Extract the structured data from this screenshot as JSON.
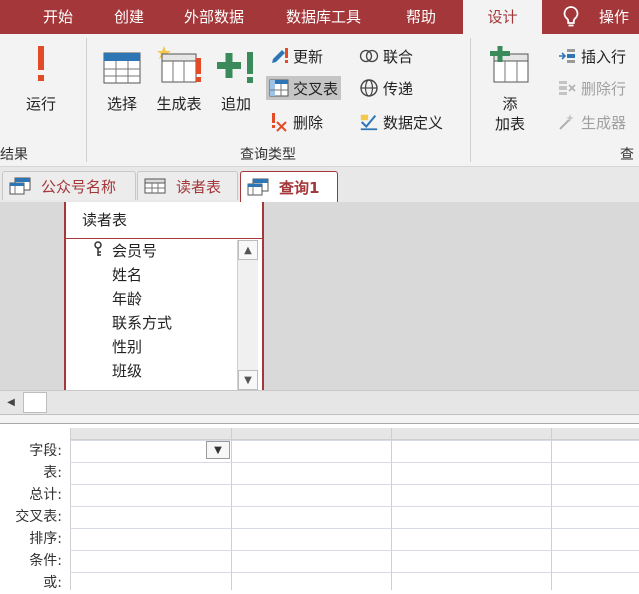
{
  "menu": {
    "tabs": [
      {
        "label": "开始"
      },
      {
        "label": "创建"
      },
      {
        "label": "外部数据"
      },
      {
        "label": "数据库工具"
      },
      {
        "label": "帮助"
      },
      {
        "label": "设计",
        "active": true
      },
      {
        "label": "操作"
      }
    ],
    "lightbulb_icon": "lightbulb-icon"
  },
  "ribbon": {
    "run": {
      "label": "运行",
      "icon": "exclamation-icon"
    },
    "select": {
      "label": "选择",
      "icon": "select-query-icon"
    },
    "make_table": {
      "label": "生成表",
      "icon": "make-table-icon"
    },
    "append": {
      "label": "追加",
      "icon": "append-icon"
    },
    "update": {
      "label": "更新",
      "icon": "pencil-icon"
    },
    "crosstab": {
      "label": "交叉表",
      "icon": "crosstab-icon",
      "selected": true
    },
    "delete": {
      "label": "删除",
      "icon": "delete-icon"
    },
    "union": {
      "label": "联合",
      "icon": "union-icon"
    },
    "pass_through": {
      "label": "传递",
      "icon": "globe-icon"
    },
    "data_definition": {
      "label": "数据定义",
      "icon": "data-definition-icon"
    },
    "add_table": {
      "label_line1": "添",
      "label_line2": "加表",
      "icon": "add-table-icon"
    },
    "insert_row": {
      "label": "插入行",
      "icon": "insert-row-icon"
    },
    "delete_row": {
      "label": "删除行",
      "icon": "delete-row-icon",
      "disabled": true
    },
    "builder": {
      "label": "生成器",
      "icon": "builder-icon",
      "disabled": true
    },
    "group_results": "结果",
    "group_query_type": "查询类型",
    "group_setup": "查"
  },
  "doc_tabs": [
    {
      "label": "公众号名称",
      "icon": "query-icon"
    },
    {
      "label": "读者表",
      "icon": "table-icon"
    },
    {
      "label": "查询1",
      "icon": "query-icon",
      "active": true
    }
  ],
  "table_box": {
    "title": "读者表",
    "fields": [
      "会员号",
      "姓名",
      "年龄",
      "联系方式",
      "性别",
      "班级"
    ],
    "primary_key_field": "会员号"
  },
  "qbe": {
    "row_labels": [
      "字段:",
      "表:",
      "总计:",
      "交叉表:",
      "排序:",
      "条件:",
      "或:"
    ]
  },
  "colors": {
    "accent": "#a4373a",
    "ribbon_bg": "#f3f3f3",
    "design_bg": "#d9d9d9"
  }
}
